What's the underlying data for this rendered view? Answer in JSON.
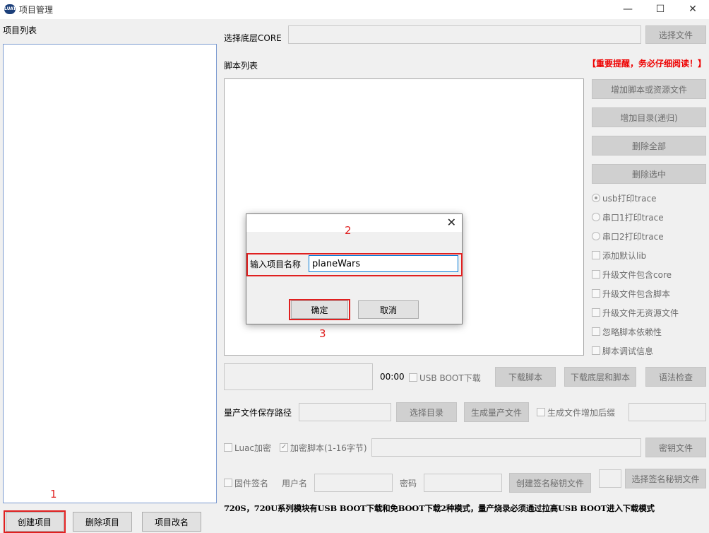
{
  "window": {
    "title": "项目管理",
    "app_icon": "LUAT",
    "minimize": "—",
    "maximize": "☐",
    "close": "✕"
  },
  "project_list": {
    "label": "项目列表",
    "buttons": {
      "create": "创建项目",
      "delete": "删除项目",
      "rename": "项目改名"
    }
  },
  "core": {
    "label": "选择底层CORE",
    "value": "",
    "select_button": "选择文件"
  },
  "scripts": {
    "label": "脚本列表",
    "warning": "【重要提醒，务必仔细阅读！】",
    "buttons": {
      "add_script": "增加脚本或资源文件",
      "add_dir": "增加目录(递归)",
      "delete_all": "删除全部",
      "delete_selected": "删除选中"
    },
    "trace_options": [
      {
        "label": "usb打印trace",
        "selected": true
      },
      {
        "label": "串口1打印trace",
        "selected": false
      },
      {
        "label": "串口2打印trace",
        "selected": false
      }
    ],
    "check_options": [
      {
        "label": "添加默认lib",
        "checked": false
      },
      {
        "label": "升级文件包含core",
        "checked": false
      },
      {
        "label": "升级文件包含脚本",
        "checked": false
      },
      {
        "label": "升级文件无资源文件",
        "checked": false
      },
      {
        "label": "忽略脚本依赖性",
        "checked": false
      },
      {
        "label": "脚本调试信息",
        "checked": false
      }
    ]
  },
  "download": {
    "progress": 0,
    "timer": "00:00",
    "usb_boot_label": "USB BOOT下载",
    "usb_boot_checked": false,
    "download_script": "下载脚本",
    "download_core_script": "下载底层和脚本",
    "syntax_check": "语法检查"
  },
  "production": {
    "label": "量产文件保存路径",
    "path": "",
    "select_dir": "选择目录",
    "generate": "生成量产文件",
    "suffix_label": "生成文件增加后缀",
    "suffix_checked": false,
    "suffix_value": ""
  },
  "encrypt": {
    "luac_label": "Luac加密",
    "luac_checked": false,
    "encrypt_script_label": "加密脚本(1-16字节)",
    "encrypt_script_checked": true,
    "key_value": "",
    "key_file_button": "密钥文件"
  },
  "signature": {
    "firmware_sign_label": "固件签名",
    "firmware_sign_checked": false,
    "username_label": "用户名",
    "username": "",
    "password_label": "密码",
    "password": "",
    "create_key_file": "创建签名秘钥文件",
    "select_key_file": "选择签名秘钥文件"
  },
  "notice": "720S，720U系列模块有USB BOOT下载和免BOOT下载2种模式，量产烧录必须通过拉高USB BOOT进入下载模式",
  "dialog": {
    "prompt": "输入项目名称",
    "input_value": "planeWars",
    "ok": "确定",
    "cancel": "取消",
    "close": "✕"
  },
  "annotations": {
    "step1": "1",
    "step2": "2",
    "step3": "3"
  },
  "colors": {
    "highlight_red": "#e02020",
    "warning_red": "#ee0000",
    "app_icon_blue": "#1c3f7a"
  }
}
